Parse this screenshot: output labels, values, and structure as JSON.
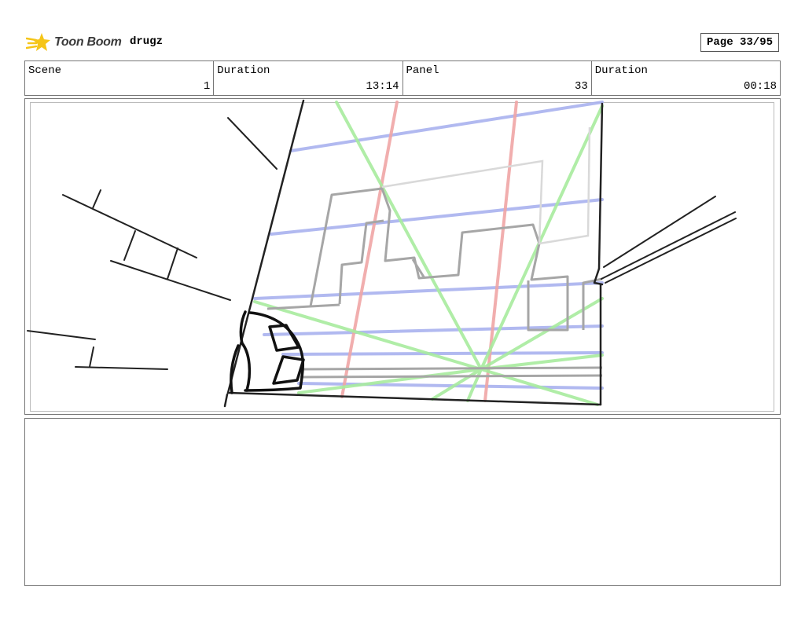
{
  "header": {
    "brand": "Toon Boom",
    "project": "drugz",
    "page_label": "Page 33/95"
  },
  "info": {
    "scene_label": "Scene",
    "scene_value": "1",
    "duration_label": "Duration",
    "duration_value": "13:14",
    "panel_label": "Panel",
    "panel_value": "33",
    "panel_duration_label": "Duration",
    "panel_duration_value": "00:18"
  },
  "panel": {
    "icon": "storyboard-sketch",
    "colors": {
      "blue_guides": "#a9b2ef",
      "red_guides": "#f0a6a6",
      "green_guides": "#a8ec9e",
      "sketch_gray": "#a6a6a6",
      "ink": "#222222"
    }
  },
  "notes": {
    "text": ""
  }
}
